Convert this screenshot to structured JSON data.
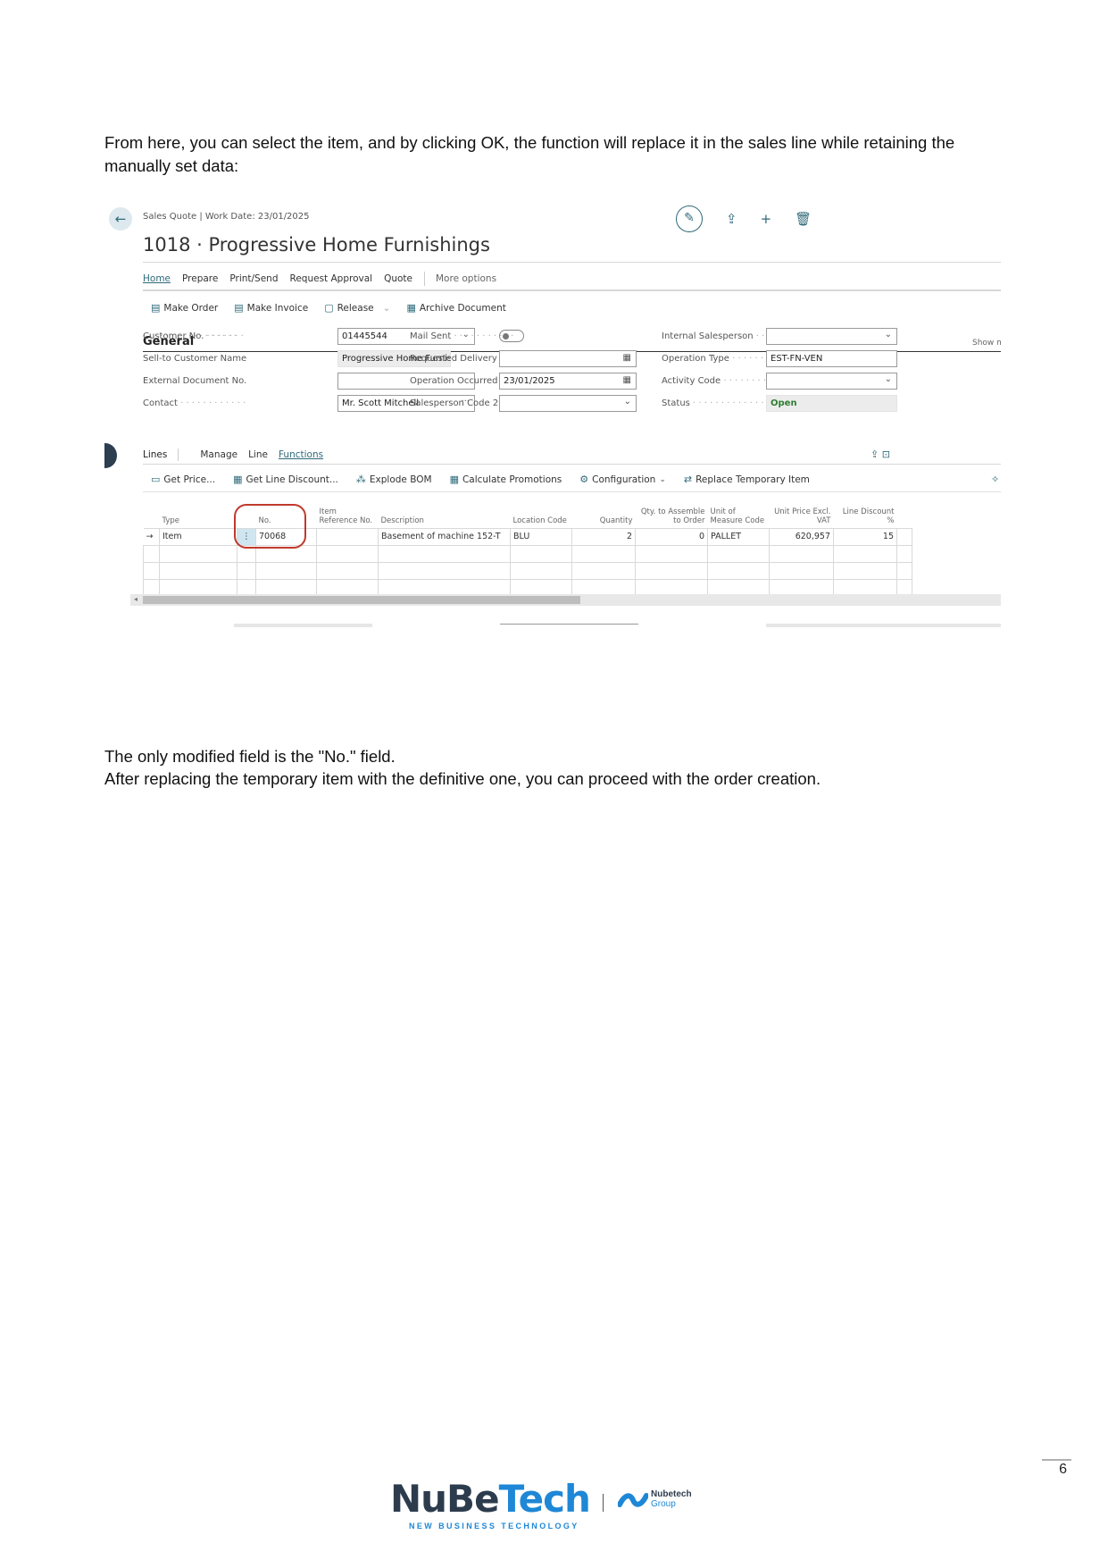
{
  "document": {
    "intro": "From here, you can select the item, and by clicking OK, the function will replace it in the sales line while retaining the manually set data:",
    "outro_line1": "The only modified field is the \"No.\" field.",
    "outro_line2": "After replacing the temporary item with the definitive one, you can proceed with the order creation.",
    "page_number": "6"
  },
  "screenshot": {
    "breadcrumb": "Sales Quote | Work Date: 23/01/2025",
    "title": "1018 · Progressive Home Furnishings",
    "menu": [
      "Home",
      "Prepare",
      "Print/Send",
      "Request Approval",
      "Quote"
    ],
    "menu_more": "More options",
    "actions": [
      "Make Order",
      "Make Invoice",
      "Release",
      "Archive Document"
    ],
    "general": {
      "heading": "General",
      "show_more": "Show mo",
      "customer_no_label": "Customer No.",
      "customer_no": "01445544",
      "sell_to_label": "Sell-to Customer Name",
      "sell_to": "Progressive Home Furnishings",
      "external_doc_label": "External Document No.",
      "external_doc": "",
      "contact_label": "Contact",
      "contact": "Mr. Scott Mitchell",
      "mail_sent_label": "Mail Sent",
      "requested_delivery_label": "Requested Delivery Date",
      "requested_delivery": "",
      "operation_occurred_label": "Operation Occurred Da...",
      "operation_occurred": "23/01/2025",
      "salesperson2_label": "Salesperson Code 2",
      "salesperson2": "",
      "internal_salesperson_label": "Internal Salesperson",
      "internal_salesperson": "",
      "operation_type_label": "Operation Type",
      "operation_type": "EST-FN-VEN",
      "activity_code_label": "Activity Code",
      "activity_code": "",
      "status_label": "Status",
      "status": "Open"
    },
    "lines": {
      "tabs": [
        "Lines",
        "Manage",
        "Line",
        "Functions"
      ],
      "actions": [
        "Get Price...",
        "Get Line Discount...",
        "Explode BOM",
        "Calculate Promotions",
        "Configuration",
        "Replace Temporary Item"
      ],
      "columns": [
        "Type",
        "No.",
        "Item Reference No.",
        "Description",
        "Location Code",
        "Quantity",
        "Qty. to Assemble to Order",
        "Unit of Measure Code",
        "Unit Price Excl. VAT",
        "Line Discount %"
      ],
      "row": {
        "type": "Item",
        "no": "70068",
        "item_ref": "",
        "description": "Basement of machine 152-T",
        "location": "BLU",
        "quantity": "2",
        "qty_assemble": "0",
        "uom": "PALLET",
        "unit_price": "620,957",
        "line_discount": "15"
      }
    }
  },
  "footer": {
    "logo_text_a": "NuBe",
    "logo_text_b": "Tech",
    "logo_sub": "NEW BUSINESS TECHNOLOGY",
    "group_name": "Nubetech",
    "group_sub": "Group"
  },
  "colors": {
    "accent": "#2f6a7a",
    "highlight": "#c0392b",
    "brand_blue": "#1e87d6",
    "brand_dark": "#2d3c4d"
  }
}
